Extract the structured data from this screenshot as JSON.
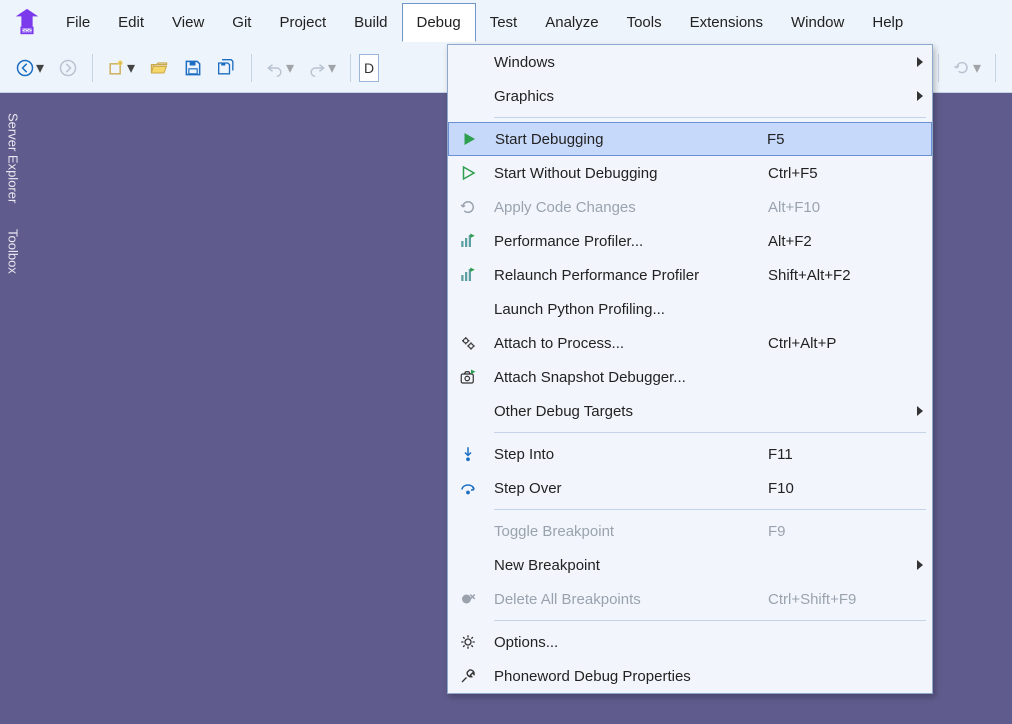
{
  "menubar": {
    "items": [
      "File",
      "Edit",
      "View",
      "Git",
      "Project",
      "Build",
      "Debug",
      "Test",
      "Analyze",
      "Tools",
      "Extensions",
      "Window",
      "Help"
    ],
    "active_index": 6
  },
  "toolbar": {
    "combo_visible_char": "D"
  },
  "side_tabs": [
    "Server Explorer",
    "Toolbox"
  ],
  "debug_menu": {
    "groups": [
      [
        {
          "id": "windows",
          "label": "Windows",
          "submenu": true
        },
        {
          "id": "graphics",
          "label": "Graphics",
          "submenu": true
        }
      ],
      [
        {
          "id": "start-debug",
          "label": "Start Debugging",
          "shortcut": "F5",
          "icon": "play-solid",
          "highlight": true
        },
        {
          "id": "start-nodebug",
          "label": "Start Without Debugging",
          "shortcut": "Ctrl+F5",
          "icon": "play-outline"
        },
        {
          "id": "apply-code",
          "label": "Apply Code Changes",
          "shortcut": "Alt+F10",
          "icon": "refresh",
          "disabled": true
        },
        {
          "id": "perf-profiler",
          "label": "Performance Profiler...",
          "shortcut": "Alt+F2",
          "icon": "chart-play"
        },
        {
          "id": "relaunch-profiler",
          "label": "Relaunch Performance Profiler",
          "shortcut": "Shift+Alt+F2",
          "icon": "chart-play"
        },
        {
          "id": "launch-python",
          "label": "Launch Python Profiling..."
        },
        {
          "id": "attach-process",
          "label": "Attach to Process...",
          "shortcut": "Ctrl+Alt+P",
          "icon": "gears"
        },
        {
          "id": "attach-snapshot",
          "label": "Attach Snapshot Debugger...",
          "icon": "camera-play"
        },
        {
          "id": "other-targets",
          "label": "Other Debug Targets",
          "submenu": true
        }
      ],
      [
        {
          "id": "step-into",
          "label": "Step Into",
          "shortcut": "F11",
          "icon": "step-into"
        },
        {
          "id": "step-over",
          "label": "Step Over",
          "shortcut": "F10",
          "icon": "step-over"
        }
      ],
      [
        {
          "id": "toggle-bp",
          "label": "Toggle Breakpoint",
          "shortcut": "F9",
          "disabled": true
        },
        {
          "id": "new-bp",
          "label": "New Breakpoint",
          "submenu": true
        },
        {
          "id": "delete-bp",
          "label": "Delete All Breakpoints",
          "shortcut": "Ctrl+Shift+F9",
          "icon": "bp-delete",
          "disabled": true
        }
      ],
      [
        {
          "id": "options",
          "label": "Options...",
          "icon": "gear"
        },
        {
          "id": "debug-props",
          "label": "Phoneword Debug Properties",
          "icon": "wrench"
        }
      ]
    ]
  }
}
